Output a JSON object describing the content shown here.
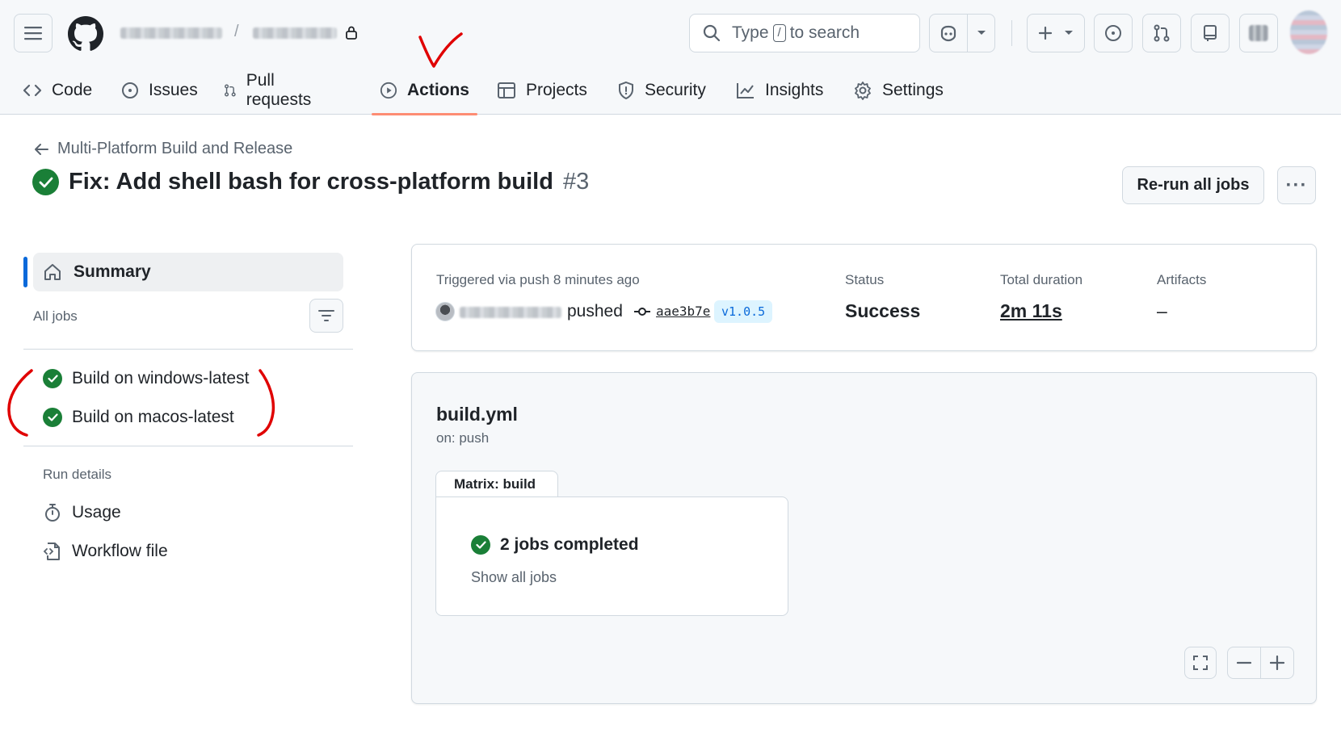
{
  "header": {
    "owner": "",
    "repo": "",
    "search": {
      "prefix": "Type",
      "key": "/",
      "suffix": "to search"
    }
  },
  "nav": {
    "tabs": [
      {
        "label": "Code",
        "icon": "code-icon"
      },
      {
        "label": "Issues",
        "icon": "issue-icon"
      },
      {
        "label": "Pull requests",
        "icon": "pull-request-icon"
      },
      {
        "label": "Actions",
        "icon": "play-icon",
        "active": true
      },
      {
        "label": "Projects",
        "icon": "table-icon"
      },
      {
        "label": "Security",
        "icon": "shield-icon"
      },
      {
        "label": "Insights",
        "icon": "graph-icon"
      },
      {
        "label": "Settings",
        "icon": "gear-icon"
      }
    ]
  },
  "run": {
    "workflow_name": "Multi-Platform Build and Release",
    "title": "Fix: Add shell bash for cross-platform build",
    "number": "#3",
    "rerun_label": "Re-run all jobs",
    "more_label": "···"
  },
  "sidebar": {
    "summary": "Summary",
    "all_jobs": "All jobs",
    "jobs": [
      "Build on windows-latest",
      "Build on macos-latest"
    ],
    "run_details": "Run details",
    "usage": "Usage",
    "workflow_file": "Workflow file"
  },
  "summary_card": {
    "trigger": "Triggered via push 8 minutes ago",
    "pushed": "pushed",
    "commit": "aae3b7e",
    "tag": "v1.0.5",
    "status_label": "Status",
    "status_value": "Success",
    "duration_label": "Total duration",
    "duration_value": "2m 11s",
    "artifacts_label": "Artifacts",
    "artifacts_value": "–"
  },
  "workflow_card": {
    "file": "build.yml",
    "on": "on: push",
    "matrix_label": "Matrix: build",
    "jobs_completed": "2 jobs completed",
    "show_all": "Show all jobs"
  },
  "colors": {
    "success": "#1a7f37",
    "accent": "#0969da",
    "active_tab_underline": "#fd8c73",
    "annotation": "#e00000"
  }
}
